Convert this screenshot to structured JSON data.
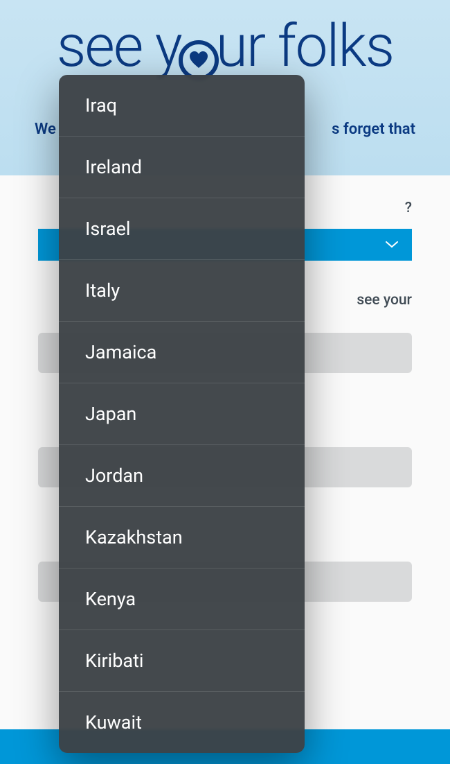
{
  "logo": {
    "line1_front": "see y",
    "line1_back": "ur folks"
  },
  "tagline_left": "We",
  "tagline_right": "s forget that",
  "form": {
    "question1_suffix": "?",
    "question2_suffix": "see your",
    "select_placeholder": "",
    "input1": "",
    "input2": "",
    "input3": ""
  },
  "dropdown": {
    "items": [
      "Iraq",
      "Ireland",
      "Israel",
      "Italy",
      "Jamaica",
      "Japan",
      "Jordan",
      "Kazakhstan",
      "Kenya",
      "Kiribati",
      "Kuwait"
    ]
  },
  "colors": {
    "primary": "#0097d8",
    "dark_blue": "#0b3a82",
    "popover_bg": "rgba(60,66,70,0.96)"
  }
}
